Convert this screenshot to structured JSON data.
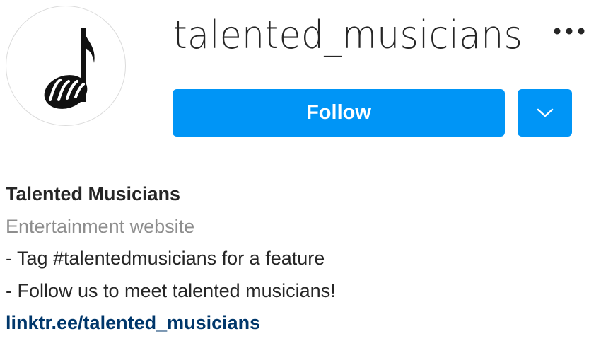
{
  "profile": {
    "username": "talented_musicians",
    "avatar_icon": "music-note-logo-icon",
    "more_icon": "more-options-icon"
  },
  "actions": {
    "follow_label": "Follow",
    "dropdown_icon": "chevron-down-icon",
    "accent_color": "#0095f6"
  },
  "bio": {
    "full_name": "Talented Musicians",
    "category": "Entertainment website",
    "lines": [
      "- Tag #talentedmusicians for a feature",
      "- Follow us to meet talented musicians!"
    ],
    "link": "linktr.ee/talented_musicians"
  }
}
